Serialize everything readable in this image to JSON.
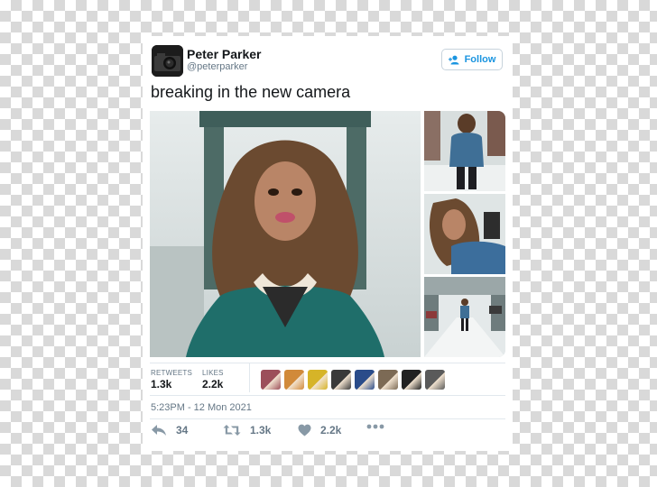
{
  "tweet": {
    "author": {
      "name": "Peter Parker",
      "handle": "@peterparker",
      "avatar_icon": "avatar-image"
    },
    "follow_button": {
      "label": "Follow",
      "icon": "add-user-icon",
      "color": "#1b95e0"
    },
    "text": "breaking in the new camera",
    "photos": [
      "main-photo",
      "photo-2",
      "photo-3",
      "photo-4"
    ],
    "stats": {
      "retweets_label": "RETWEETS",
      "retweets_value": "1.3k",
      "likes_label": "LIKES",
      "likes_value": "2.2k",
      "liker_avatar_colors": [
        "#9c4f5a",
        "#d18a3a",
        "#d6b428",
        "#3a3a3a",
        "#2a4c8a",
        "#7c6a55",
        "#222222",
        "#5a5a5a"
      ]
    },
    "timestamp": "5:23PM - 12 Mon 2021",
    "actions": {
      "reply": {
        "icon": "reply-icon",
        "count": "34"
      },
      "retweet": {
        "icon": "retweet-icon",
        "count": "1.3k"
      },
      "like": {
        "icon": "heart-icon",
        "count": "2.2k"
      },
      "more": {
        "icon": "more-icon"
      }
    }
  },
  "colors": {
    "text_primary": "#14171a",
    "text_secondary": "#657786",
    "accent": "#1b95e0"
  }
}
